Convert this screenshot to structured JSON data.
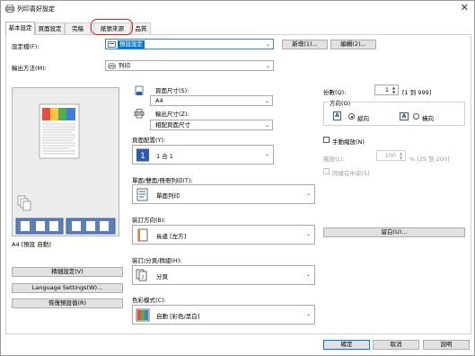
{
  "window": {
    "title": "列印喜好設定",
    "close_label": "✕"
  },
  "tabs": [
    {
      "label": "基本設定",
      "active": true
    },
    {
      "label": "頁面設定"
    },
    {
      "label": "完稿"
    },
    {
      "label": "紙張來源",
      "highlighted": true
    },
    {
      "label": "品質"
    }
  ],
  "profile": {
    "label": "設定檔(F):",
    "value": "預設設定",
    "add_button": "新增(1)...",
    "edit_button": "編輯(2)..."
  },
  "output_method": {
    "label": "輸出方法(M):",
    "value": "列印"
  },
  "preview": {
    "caption": "A4 [預設 自動]"
  },
  "left_buttons": {
    "watermark": "精細設定(V)",
    "language": "Language Settings(W)...",
    "restore": "恢復預設值(R)"
  },
  "page_size": {
    "label": "頁面尺寸(S):",
    "value": "A4"
  },
  "output_size": {
    "label": "輸出尺寸(Z):",
    "value": "相配頁面尺寸"
  },
  "page_layout": {
    "label": "頁面配置(Y):",
    "value": "1 合 1"
  },
  "duplex": {
    "label": "單面/雙面/冊冊列印(T):",
    "value": "單面列印"
  },
  "binding": {
    "label": "裝訂方向(B):",
    "value": "長邊 [左方]",
    "button": "留白(U)..."
  },
  "finishing": {
    "label": "裝訂/分頁/群組(H):",
    "value": "分頁"
  },
  "color_mode": {
    "label": "色彩模式(C):",
    "value": "自動 [彩色/黑白]"
  },
  "copies": {
    "label": "份數(Q):",
    "value": "1",
    "range": "[1 到 999]"
  },
  "orientation": {
    "legend": "方向(O)",
    "portrait": "縱向",
    "landscape": "橫向",
    "selected": "portrait"
  },
  "manual_scaling": {
    "label": "手動縮放(N)",
    "scale_label": "縮放(L):",
    "scale_value": "100",
    "scale_range": "% [25 到 200]",
    "fit_label": "同樣在中央(5)"
  },
  "footer": {
    "ok": "確定",
    "cancel": "取消",
    "help": "說明"
  },
  "colors": {
    "accent": "#0078d7",
    "highlight_ring": "#e0231a"
  }
}
